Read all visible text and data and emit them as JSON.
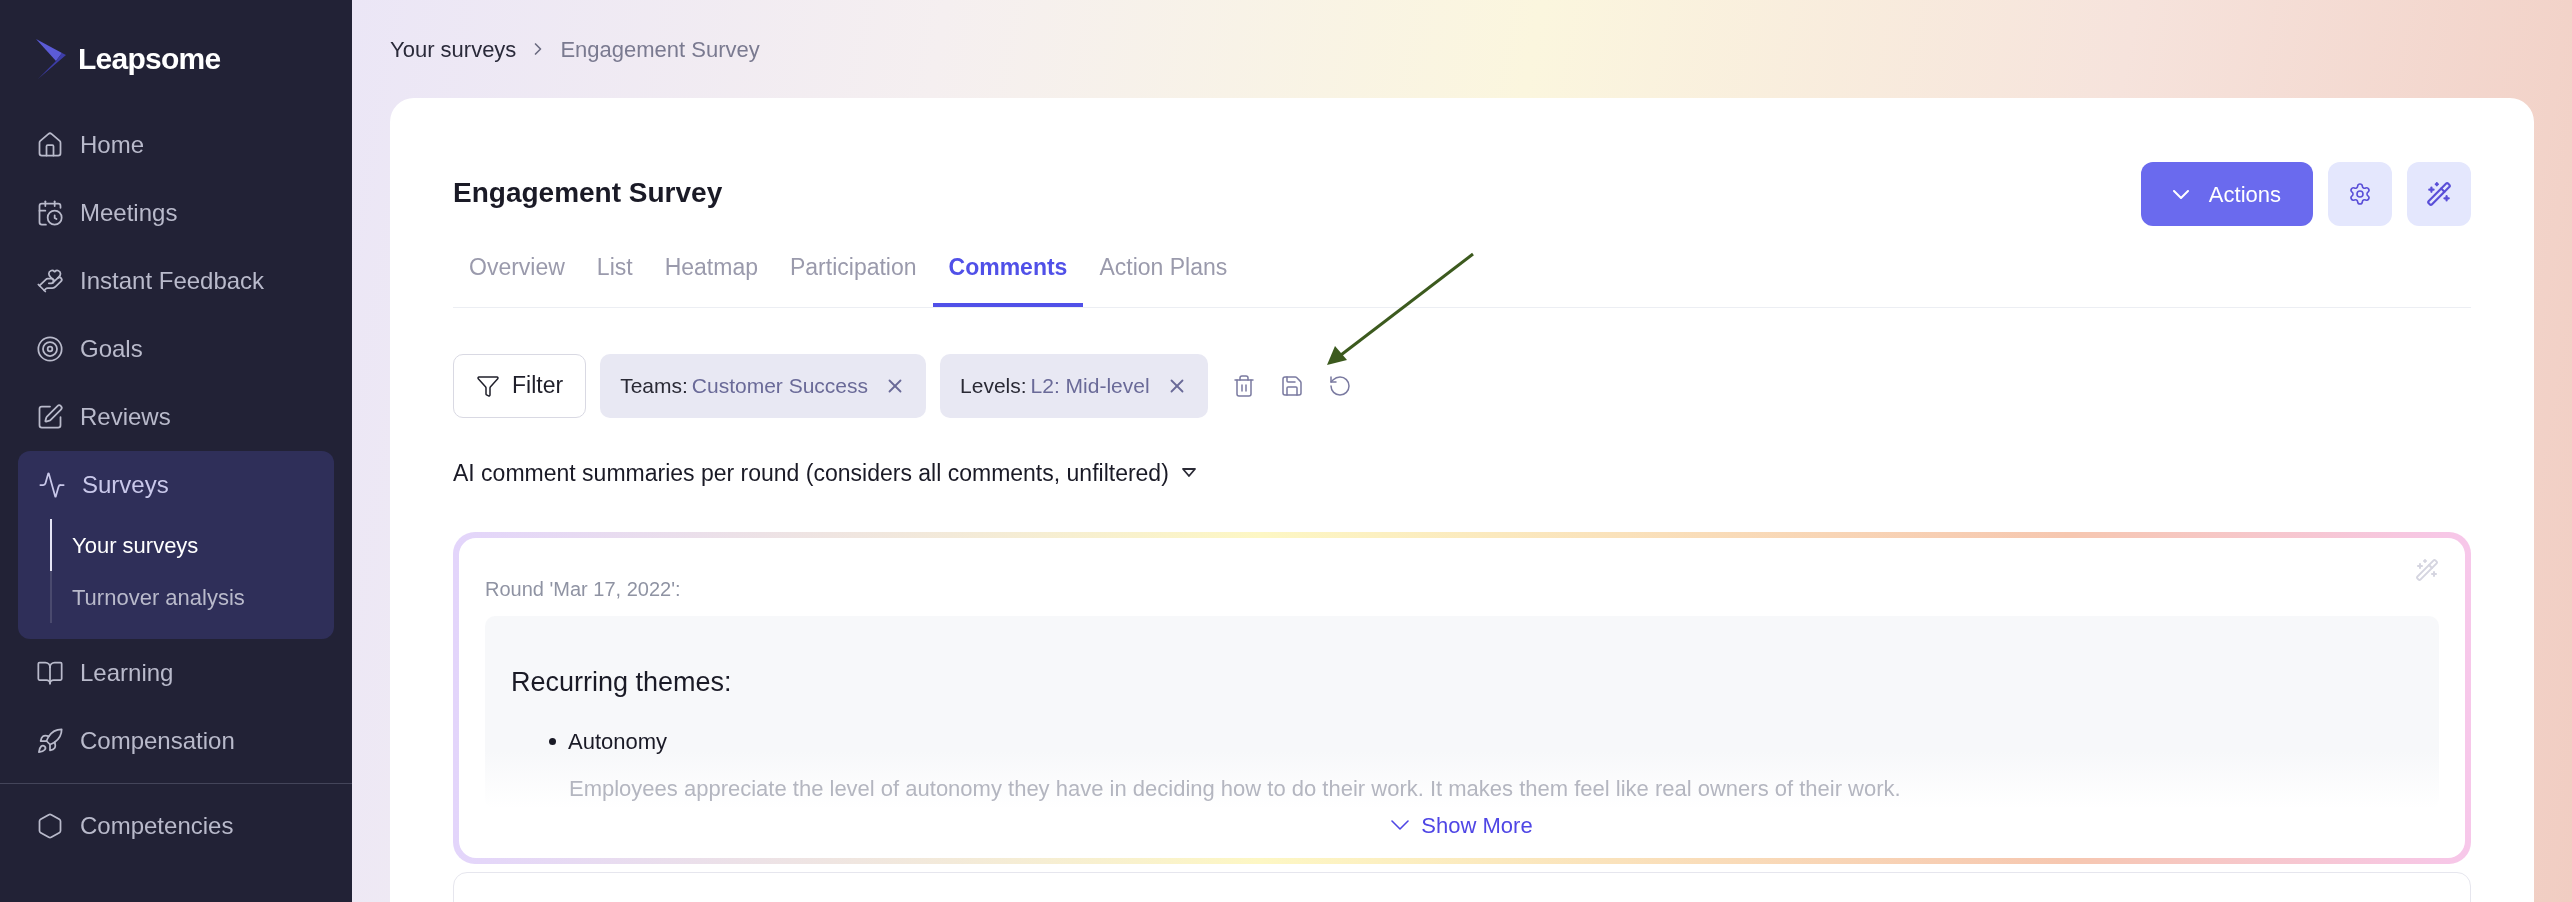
{
  "sidebar": {
    "logo": "Leapsome",
    "items": [
      {
        "label": "Home",
        "selected": false
      },
      {
        "label": "Meetings",
        "selected": false
      },
      {
        "label": "Instant Feedback",
        "selected": false
      },
      {
        "label": "Goals",
        "selected": false
      },
      {
        "label": "Reviews",
        "selected": false
      },
      {
        "label": "Surveys",
        "selected": true,
        "expanded": true,
        "children": [
          {
            "label": "Your surveys",
            "selected": true
          },
          {
            "label": "Turnover analysis",
            "selected": false
          }
        ]
      },
      {
        "label": "Learning",
        "selected": false
      },
      {
        "label": "Compensation",
        "selected": false
      }
    ],
    "secondary_items": [
      {
        "label": "Competencies",
        "selected": false
      }
    ]
  },
  "breadcrumbs": [
    "Your surveys",
    "Engagement Survey"
  ],
  "page": {
    "title": "Engagement Survey",
    "actions_button": "Actions",
    "tabs": [
      {
        "label": "Overview",
        "selected": false
      },
      {
        "label": "List",
        "selected": false
      },
      {
        "label": "Heatmap",
        "selected": false
      },
      {
        "label": "Participation",
        "selected": false
      },
      {
        "label": "Comments",
        "selected": true
      },
      {
        "label": "Action Plans",
        "selected": false
      }
    ],
    "filter_button": "Filter",
    "filters": [
      {
        "key": "Teams:",
        "value": "Customer Success"
      },
      {
        "key": "Levels:",
        "value": "L2: Mid-level"
      }
    ],
    "summaries_heading": "AI comment summaries per round (considers all comments, unfiltered)",
    "summary": {
      "round": "Round 'Mar 17, 2022':",
      "heading": "Recurring themes:",
      "themes": [
        {
          "title": "Autonomy",
          "text": "Employees appreciate the level of autonomy they have in deciding how to do their work. It makes them feel like real owners of their work."
        }
      ],
      "show_more": "Show More"
    }
  }
}
